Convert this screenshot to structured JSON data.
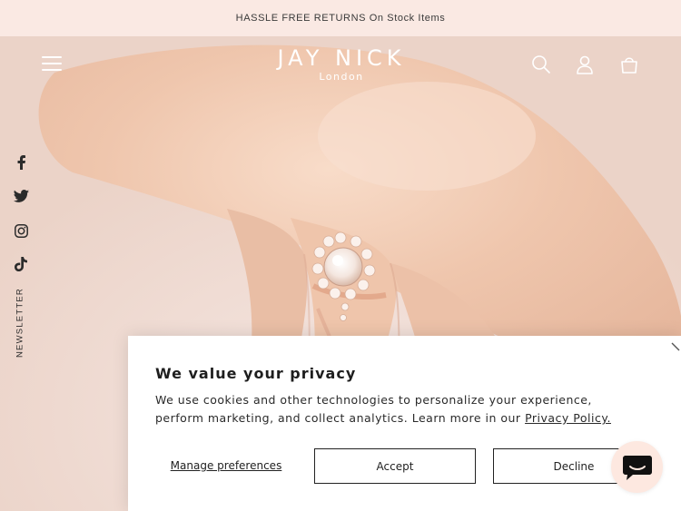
{
  "announcement": {
    "text": "HASSLE FREE RETURNS On Stock Items"
  },
  "header": {
    "logo_main": "JAY NICK",
    "logo_sub": "London",
    "icons": [
      "menu-icon",
      "search-icon",
      "account-icon",
      "cart-icon"
    ]
  },
  "social": {
    "items": [
      "Facebook",
      "Twitter",
      "Instagram",
      "TikTok"
    ],
    "newsletter_label": "NEWSLETTER"
  },
  "consent": {
    "title": "We value your privacy",
    "message": "We use cookies and other technologies to personalize your experience, perform marketing, and collect analytics. Learn more in our",
    "privacy_link": "Privacy Policy.",
    "manage_label": "Manage preferences",
    "accept_label": "Accept",
    "decline_label": "Decline"
  },
  "colors": {
    "announcement_bg": "#fae9e3",
    "text_dark": "#2a2a2a",
    "header_icons": "#ffffff",
    "chat_bg": "#fde8e0"
  }
}
